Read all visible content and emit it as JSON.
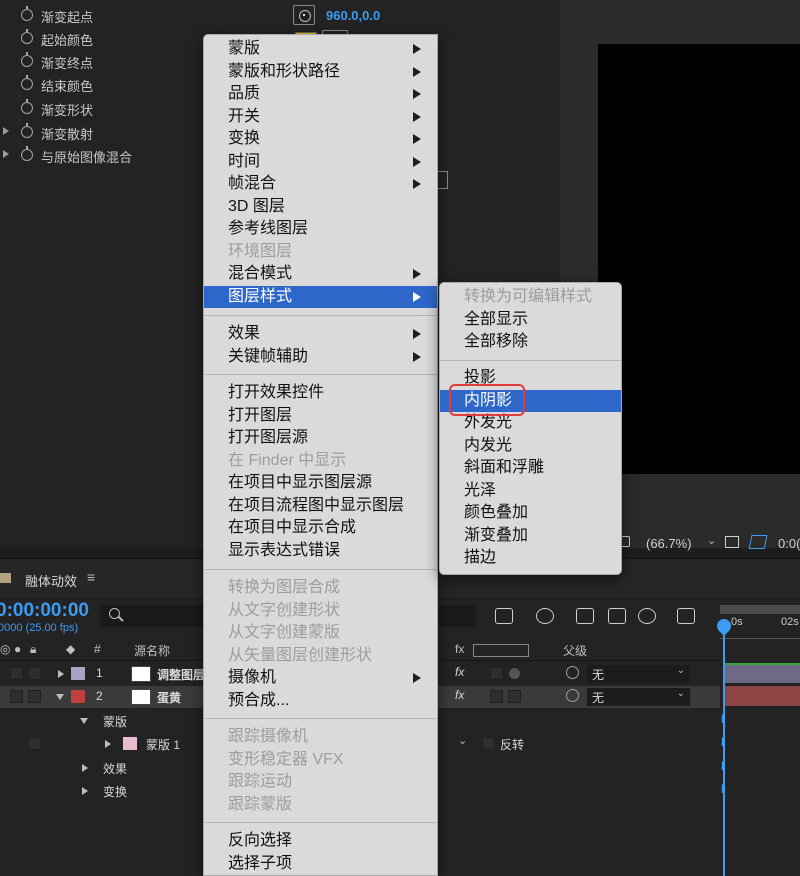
{
  "effect_controls": {
    "properties": [
      {
        "label": "渐变起点",
        "has_twirl": false
      },
      {
        "label": "起始颜色",
        "has_twirl": false
      },
      {
        "label": "渐变终点",
        "has_twirl": false
      },
      {
        "label": "结束颜色",
        "has_twirl": false
      },
      {
        "label": "渐变形状",
        "has_twirl": false
      },
      {
        "label": "渐变散射",
        "has_twirl": true
      },
      {
        "label": "与原始图像混合",
        "has_twirl": true
      }
    ],
    "start_point_value": "960.0,0.0",
    "start_color": "#f4c20d"
  },
  "viewer": {
    "zoom": "(66.7%)",
    "timecode_partial": "0:0("
  },
  "timeline": {
    "comp_name": "融体动效",
    "menu_glyph": "≡",
    "timecode": "0:00:00:00",
    "fps": "0000 (25.00 fps)",
    "headers": {
      "number": "#",
      "source_name": "源名称",
      "parent": "父级"
    },
    "ruler": {
      "start": "0s",
      "next": "02s"
    },
    "layers": [
      {
        "index": "1",
        "name": "调整图层",
        "label_color": "#a8a4c8",
        "parent": "无",
        "selected": false
      },
      {
        "index": "2",
        "name": "蛋黄",
        "label_color": "#c04040",
        "parent": "无",
        "selected": true
      }
    ],
    "sub_rows": {
      "masks": "蒙版",
      "mask1": "蒙版 1",
      "invert": "反转",
      "effects": "效果",
      "transform": "变换"
    }
  },
  "context_menu": {
    "items": [
      {
        "label": "蒙版",
        "submenu": true,
        "disabled": false
      },
      {
        "label": "蒙版和形状路径",
        "submenu": true,
        "disabled": false
      },
      {
        "label": "品质",
        "submenu": true,
        "disabled": false
      },
      {
        "label": "开关",
        "submenu": true,
        "disabled": false
      },
      {
        "label": "变换",
        "submenu": true,
        "disabled": false
      },
      {
        "label": "时间",
        "submenu": true,
        "disabled": false
      },
      {
        "label": "帧混合",
        "submenu": true,
        "disabled": false
      },
      {
        "label": "3D 图层",
        "submenu": false,
        "disabled": false
      },
      {
        "label": "参考线图层",
        "submenu": false,
        "disabled": false
      },
      {
        "label": "环境图层",
        "submenu": false,
        "disabled": true
      },
      {
        "label": "混合模式",
        "submenu": true,
        "disabled": false
      },
      {
        "label": "图层样式",
        "submenu": true,
        "disabled": false,
        "active": true
      },
      {
        "label": "效果",
        "submenu": true,
        "disabled": false
      },
      {
        "label": "关键帧辅助",
        "submenu": true,
        "disabled": false
      },
      {
        "label": "打开效果控件",
        "submenu": false,
        "disabled": false
      },
      {
        "label": "打开图层",
        "submenu": false,
        "disabled": false
      },
      {
        "label": "打开图层源",
        "submenu": false,
        "disabled": false
      },
      {
        "label": "在 Finder 中显示",
        "submenu": false,
        "disabled": true
      },
      {
        "label": "在项目中显示图层源",
        "submenu": false,
        "disabled": false
      },
      {
        "label": "在项目流程图中显示图层",
        "submenu": false,
        "disabled": false
      },
      {
        "label": "在项目中显示合成",
        "submenu": false,
        "disabled": false
      },
      {
        "label": "显示表达式错误",
        "submenu": false,
        "disabled": false
      },
      {
        "label": "转换为图层合成",
        "submenu": false,
        "disabled": true
      },
      {
        "label": "从文字创建形状",
        "submenu": false,
        "disabled": true
      },
      {
        "label": "从文字创建蒙版",
        "submenu": false,
        "disabled": true
      },
      {
        "label": "从矢量图层创建形状",
        "submenu": false,
        "disabled": true
      },
      {
        "label": "摄像机",
        "submenu": true,
        "disabled": false
      },
      {
        "label": "预合成...",
        "submenu": false,
        "disabled": false
      },
      {
        "label": "跟踪摄像机",
        "submenu": false,
        "disabled": true
      },
      {
        "label": "变形稳定器 VFX",
        "submenu": false,
        "disabled": true
      },
      {
        "label": "跟踪运动",
        "submenu": false,
        "disabled": true
      },
      {
        "label": "跟踪蒙版",
        "submenu": false,
        "disabled": true
      },
      {
        "label": "反向选择",
        "submenu": false,
        "disabled": false
      },
      {
        "label": "选择子项",
        "submenu": false,
        "disabled": false
      }
    ]
  },
  "submenu": {
    "items": [
      {
        "label": "转换为可编辑样式",
        "disabled": true
      },
      {
        "label": "全部显示",
        "disabled": false
      },
      {
        "label": "全部移除",
        "disabled": false
      },
      {
        "label": "投影",
        "disabled": false
      },
      {
        "label": "内阴影",
        "disabled": false,
        "active": true
      },
      {
        "label": "外发光",
        "disabled": false
      },
      {
        "label": "内发光",
        "disabled": false
      },
      {
        "label": "斜面和浮雕",
        "disabled": false
      },
      {
        "label": "光泽",
        "disabled": false
      },
      {
        "label": "颜色叠加",
        "disabled": false
      },
      {
        "label": "渐变叠加",
        "disabled": false
      },
      {
        "label": "描边",
        "disabled": false
      }
    ]
  },
  "colors": {
    "accent_blue": "#3a9cf2",
    "menu_highlight": "#2e67c9",
    "annotation_red": "#e23b3b"
  }
}
